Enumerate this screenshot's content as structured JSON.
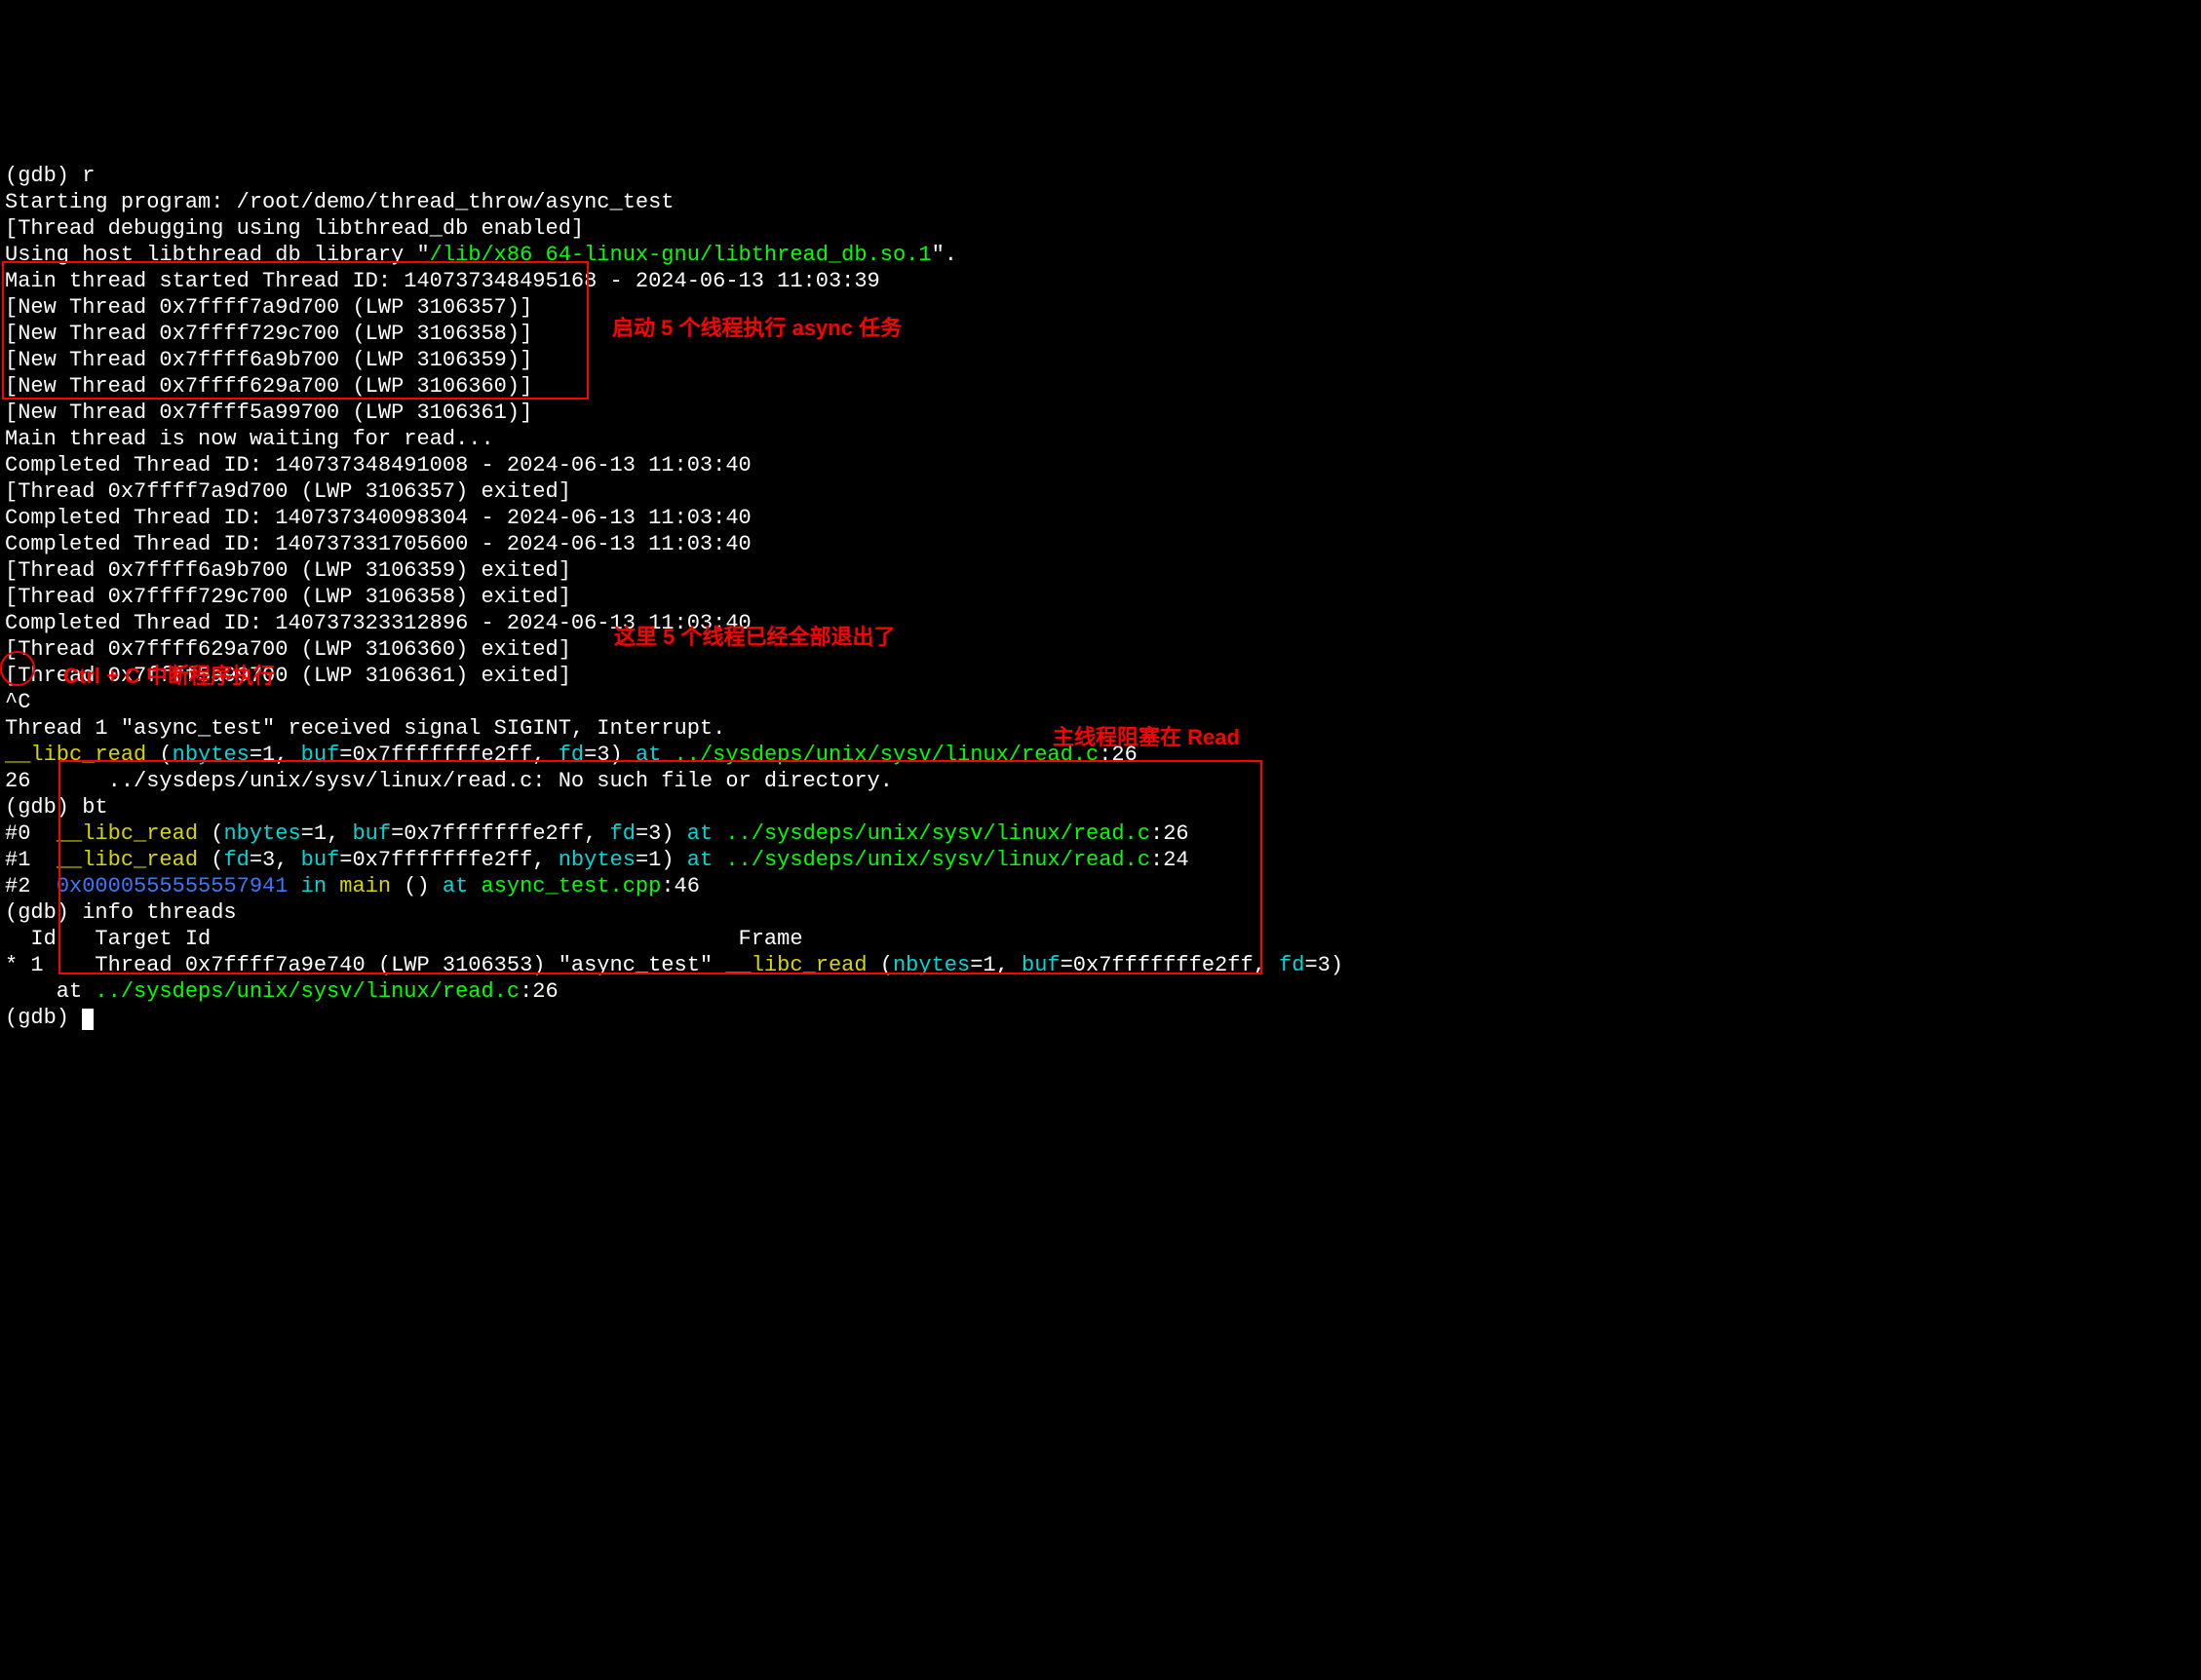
{
  "lines": {
    "prompt_r": "(gdb) r",
    "starting": "Starting program: /root/demo/thread_throw/async_test",
    "thread_db_enabled": "[Thread debugging using libthread_db enabled]",
    "using_host_pre": "Using host libthread_db library \"",
    "using_host_path": "/lib/x86_64-linux-gnu/libthread_db.so.1",
    "using_host_post": "\".",
    "main_started": "Main thread started Thread ID: 140737348495168 - 2024-06-13 11:03:39",
    "new1": "[New Thread 0x7ffff7a9d700 (LWP 3106357)]",
    "new2": "[New Thread 0x7ffff729c700 (LWP 3106358)]",
    "new3": "[New Thread 0x7ffff6a9b700 (LWP 3106359)]",
    "new4": "[New Thread 0x7ffff629a700 (LWP 3106360)]",
    "new5": "[New Thread 0x7ffff5a99700 (LWP 3106361)]",
    "waiting": "Main thread is now waiting for read...",
    "comp1": "Completed Thread ID: 140737348491008 - 2024-06-13 11:03:40",
    "exit1": "[Thread 0x7ffff7a9d700 (LWP 3106357) exited]",
    "comp2": "Completed Thread ID: 140737340098304 - 2024-06-13 11:03:40",
    "comp3": "Completed Thread ID: 140737331705600 - 2024-06-13 11:03:40",
    "exit2": "[Thread 0x7ffff6a9b700 (LWP 3106359) exited]",
    "exit3": "[Thread 0x7ffff729c700 (LWP 3106358) exited]",
    "comp4": "Completed Thread ID: 140737323312896 - 2024-06-13 11:03:40",
    "exit4": "[Thread 0x7ffff629a700 (LWP 3106360) exited]",
    "exit5": "[Thread 0x7ffff5a99700 (LWP 3106361) exited]",
    "ctrlc": "^C",
    "sigint": "Thread 1 \"async_test\" received signal SIGINT, Interrupt.",
    "libc_read": "__libc_read",
    "nbytes": "nbytes",
    "buf": "buf",
    "fd": "fd",
    "at": "at",
    "read_path": "../sysdeps/unix/sysv/linux/read.c",
    "c26": ":26",
    "c24": ":24",
    "c46": ":46",
    "line26": "26      ../sysdeps/unix/sysv/linux/read.c: No such file or directory.",
    "gdb_bt": "(gdb) bt",
    "f0": "#0  ",
    "f1": "#1  ",
    "f2": "#2  ",
    "addr2": "0x0000555555557941",
    "in": "in",
    "main_fn": "main",
    "async_cpp": "async_test.cpp",
    "gdb_info": "(gdb) info threads",
    "hdr_id": "  Id   Target Id                                         Frame ",
    "star1": "* 1    Thread 0x7ffff7a9e740 (LWP 3106353) \"async_test\" ",
    "at_bottom": "    at ",
    "gdb_end": "(gdb) ",
    "eq1": "=1, ",
    "eq3": "=3) ",
    "eq3comma": "=3, ",
    "eq1paren": "=1) ",
    "bufval": "=0x7fffffffe2ff, ",
    "paren_open": " (",
    "empty_paren": " () "
  },
  "annotations": {
    "a1": "启动 5 个线程执行 async 任务",
    "a2": "Ctrl + C 中断程序执行",
    "a3": "这里 5 个线程已经全部退出了",
    "a4": "主线程阻塞在 Read"
  }
}
